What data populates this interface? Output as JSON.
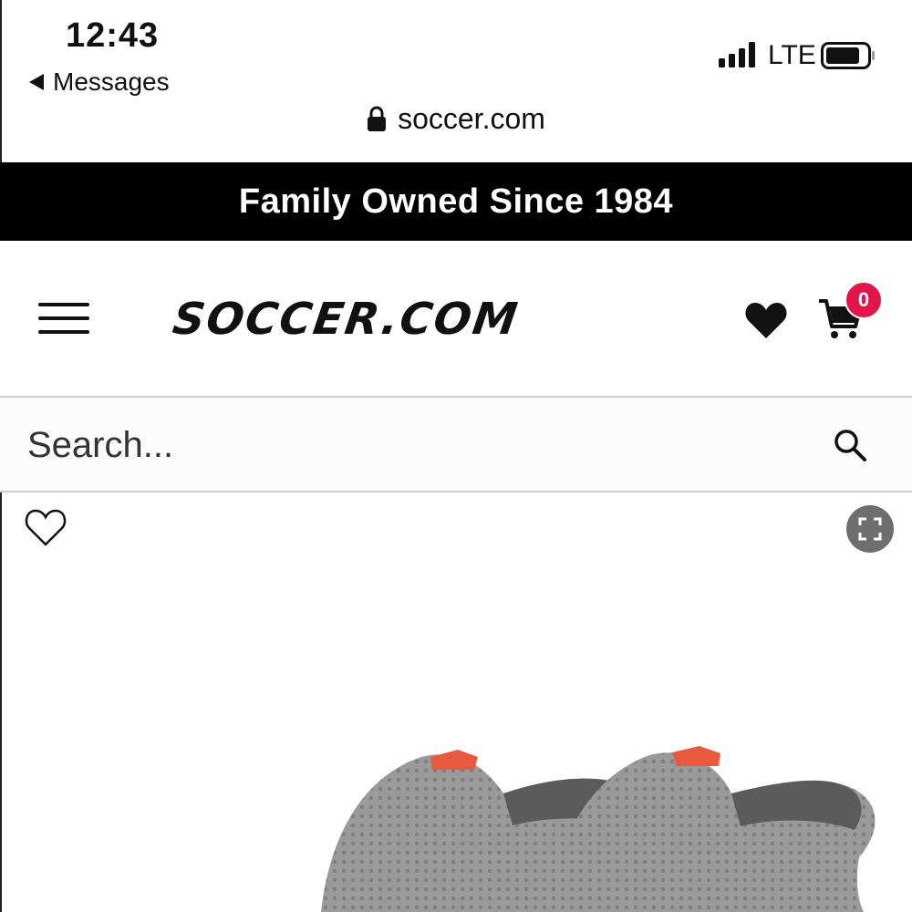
{
  "status_bar": {
    "time": "12:43",
    "back_label": "Messages",
    "carrier": "LTE"
  },
  "browser": {
    "url": "soccer.com"
  },
  "promo": {
    "text": "Family Owned Since 1984"
  },
  "header": {
    "logo": "SOCCER.COM",
    "cart_count": "0",
    "badge_color": "#e2164b"
  },
  "search": {
    "placeholder": "Search..."
  },
  "icons": {
    "menu": "hamburger-icon",
    "wishlist": "heart-icon",
    "cart": "cart-icon",
    "search": "search-icon",
    "favorite": "heart-outline-icon",
    "expand": "expand-icon",
    "secure": "lock-icon"
  }
}
